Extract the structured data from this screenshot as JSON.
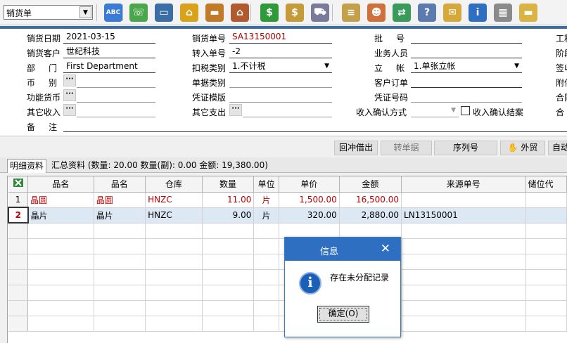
{
  "toolbar": {
    "doc_type": "销货单",
    "icons": [
      {
        "name": "spellcheck-icon",
        "glyph": "ABC",
        "color": "#3a7bd5"
      },
      {
        "name": "phone-icon",
        "glyph": "☏",
        "color": "#4aa64a"
      },
      {
        "name": "computer-icon",
        "glyph": "▭",
        "color": "#3a6ea5"
      },
      {
        "name": "lock-icon",
        "glyph": "⌂",
        "color": "#d9a21b"
      },
      {
        "name": "briefcase-icon",
        "glyph": "▬",
        "color": "#c07a28"
      },
      {
        "name": "house-icon",
        "glyph": "⌂",
        "color": "#b05a2e"
      },
      {
        "name": "dollar-icon",
        "glyph": "$",
        "color": "#2e9a3a"
      },
      {
        "name": "money-bag-icon",
        "glyph": "$",
        "color": "#c49a3a"
      },
      {
        "name": "cart-icon",
        "glyph": "⛟",
        "color": "#7a7a9a"
      },
      {
        "name": "clipboard-icon",
        "glyph": "≡",
        "color": "#c4a04a"
      },
      {
        "name": "people-icon",
        "glyph": "☻",
        "color": "#d0703a"
      },
      {
        "name": "link-icon",
        "glyph": "⇄",
        "color": "#3a9a5a"
      },
      {
        "name": "help-doc-icon",
        "glyph": "?",
        "color": "#5a7ab0"
      },
      {
        "name": "mail-icon",
        "glyph": "✉",
        "color": "#d4a83a"
      },
      {
        "name": "info-icon",
        "glyph": "i",
        "color": "#2e6fc2"
      },
      {
        "name": "calculator-icon",
        "glyph": "▦",
        "color": "#8a8a8a"
      },
      {
        "name": "folder-icon",
        "glyph": "▬",
        "color": "#d9b445"
      }
    ]
  },
  "form": {
    "sale_date_label": "销货日期",
    "sale_date": "2021-03-15",
    "customer_label": "销货客户",
    "customer": "世纪科技",
    "dept_label": "部     门",
    "dept": "First Department",
    "currency_label": "币     别",
    "func_currency_label": "功能货币",
    "other_income_label": "其它收入",
    "remark_label": "备     注",
    "sale_no_label": "销货单号",
    "sale_no": "SA13150001",
    "transfer_no_label": "转入单号",
    "transfer_no": "-2",
    "tax_type_label": "扣税类别",
    "tax_type": "1.不计税",
    "doc_type_label": "单据类别",
    "voucher_tpl_label": "凭证模版",
    "other_expense_label": "其它支出",
    "batch_label": "批     号",
    "salesman_label": "业务人员",
    "account_label": "立     帐",
    "account": "1.单张立帐",
    "cust_order_label": "客户订单",
    "voucher_no_label": "凭证号码",
    "income_confirm_label": "收入确认方式",
    "income_confirm_close_label": "收入确认结案",
    "right_edge": [
      "工程",
      "阶段",
      "签收",
      "附件",
      "合同",
      "合"
    ]
  },
  "buttons": {
    "offset": "回冲借出",
    "transfer": "转单据",
    "serial": "序列号",
    "foreign": "外贸",
    "auto": "自动"
  },
  "tabs": {
    "detail": "明细资料",
    "summary": "汇总资料 (数量: 20.00 数量(副): 0.00 金额: 19,380.00)"
  },
  "grid": {
    "columns": [
      "品名",
      "品名",
      "仓库",
      "数量",
      "单位",
      "单价",
      "金额",
      "来源单号",
      "储位代"
    ],
    "rows": [
      {
        "no": "1",
        "c1": "晶圆",
        "c2": "晶圆",
        "warehouse": "HNZC",
        "qty": "11.00",
        "unit": "片",
        "price": "1,500.00",
        "amount": "16,500.00",
        "source": ""
      },
      {
        "no": "2",
        "c1": "晶片",
        "c2": "晶片",
        "warehouse": "HNZC",
        "qty": "9.00",
        "unit": "片",
        "price": "320.00",
        "amount": "2,880.00",
        "source": "LN13150001"
      }
    ]
  },
  "dialog": {
    "title": "信息",
    "message": "存在未分配记录",
    "ok": "确定(O)"
  }
}
